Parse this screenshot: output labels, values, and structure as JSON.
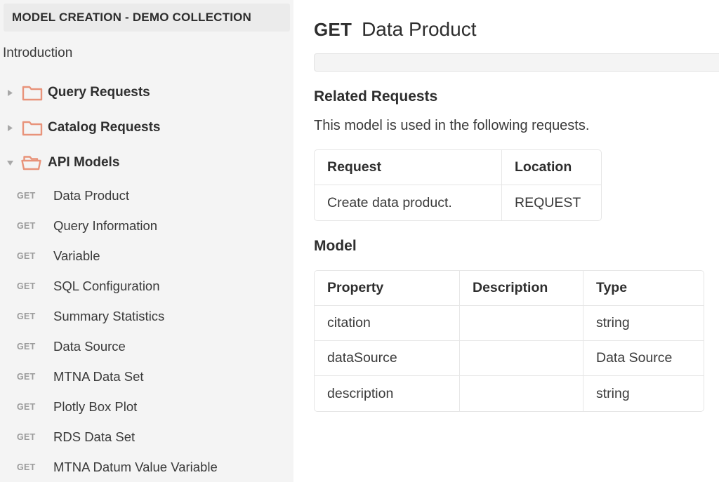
{
  "sidebar": {
    "collection_title": "MODEL CREATION - DEMO COLLECTION",
    "introduction_label": "Introduction",
    "folders": [
      {
        "label": "Query Requests",
        "expanded": false,
        "icon": "folder-closed-icon",
        "chevron": "chevron-right-icon"
      },
      {
        "label": "Catalog Requests",
        "expanded": false,
        "icon": "folder-closed-icon",
        "chevron": "chevron-right-icon"
      },
      {
        "label": "API Models",
        "expanded": true,
        "icon": "folder-open-icon",
        "chevron": "chevron-down-icon"
      }
    ],
    "requests": [
      {
        "method": "GET",
        "label": "Data Product"
      },
      {
        "method": "GET",
        "label": "Query Information"
      },
      {
        "method": "GET",
        "label": "Variable"
      },
      {
        "method": "GET",
        "label": "SQL Configuration"
      },
      {
        "method": "GET",
        "label": "Summary Statistics"
      },
      {
        "method": "GET",
        "label": "Data Source"
      },
      {
        "method": "GET",
        "label": "MTNA Data Set"
      },
      {
        "method": "GET",
        "label": "Plotly Box Plot"
      },
      {
        "method": "GET",
        "label": "RDS Data Set"
      },
      {
        "method": "GET",
        "label": "MTNA Datum Value Variable"
      }
    ]
  },
  "main": {
    "title_method": "GET",
    "title_name": "Data Product",
    "url_value": "",
    "related": {
      "heading": "Related Requests",
      "paragraph": "This model is used in the following requests.",
      "columns": [
        "Request",
        "Location"
      ],
      "rows": [
        {
          "request": "Create data product.",
          "location": "REQUEST"
        }
      ]
    },
    "model": {
      "heading": "Model",
      "columns": [
        "Property",
        "Description",
        "Type"
      ],
      "rows": [
        {
          "property": "citation",
          "description": "",
          "type": "string",
          "type_is_link": false
        },
        {
          "property": "dataSource",
          "description": "",
          "type": "Data Source",
          "type_is_link": true
        },
        {
          "property": "description",
          "description": "",
          "type": "string",
          "type_is_link": false
        }
      ]
    }
  },
  "colors": {
    "accent_orange": "#e2603c",
    "folder_orange": "#e8937a",
    "sidebar_bg": "#f4f4f4",
    "header_bg": "#ebebeb",
    "method_gray": "#9b9b9b"
  }
}
